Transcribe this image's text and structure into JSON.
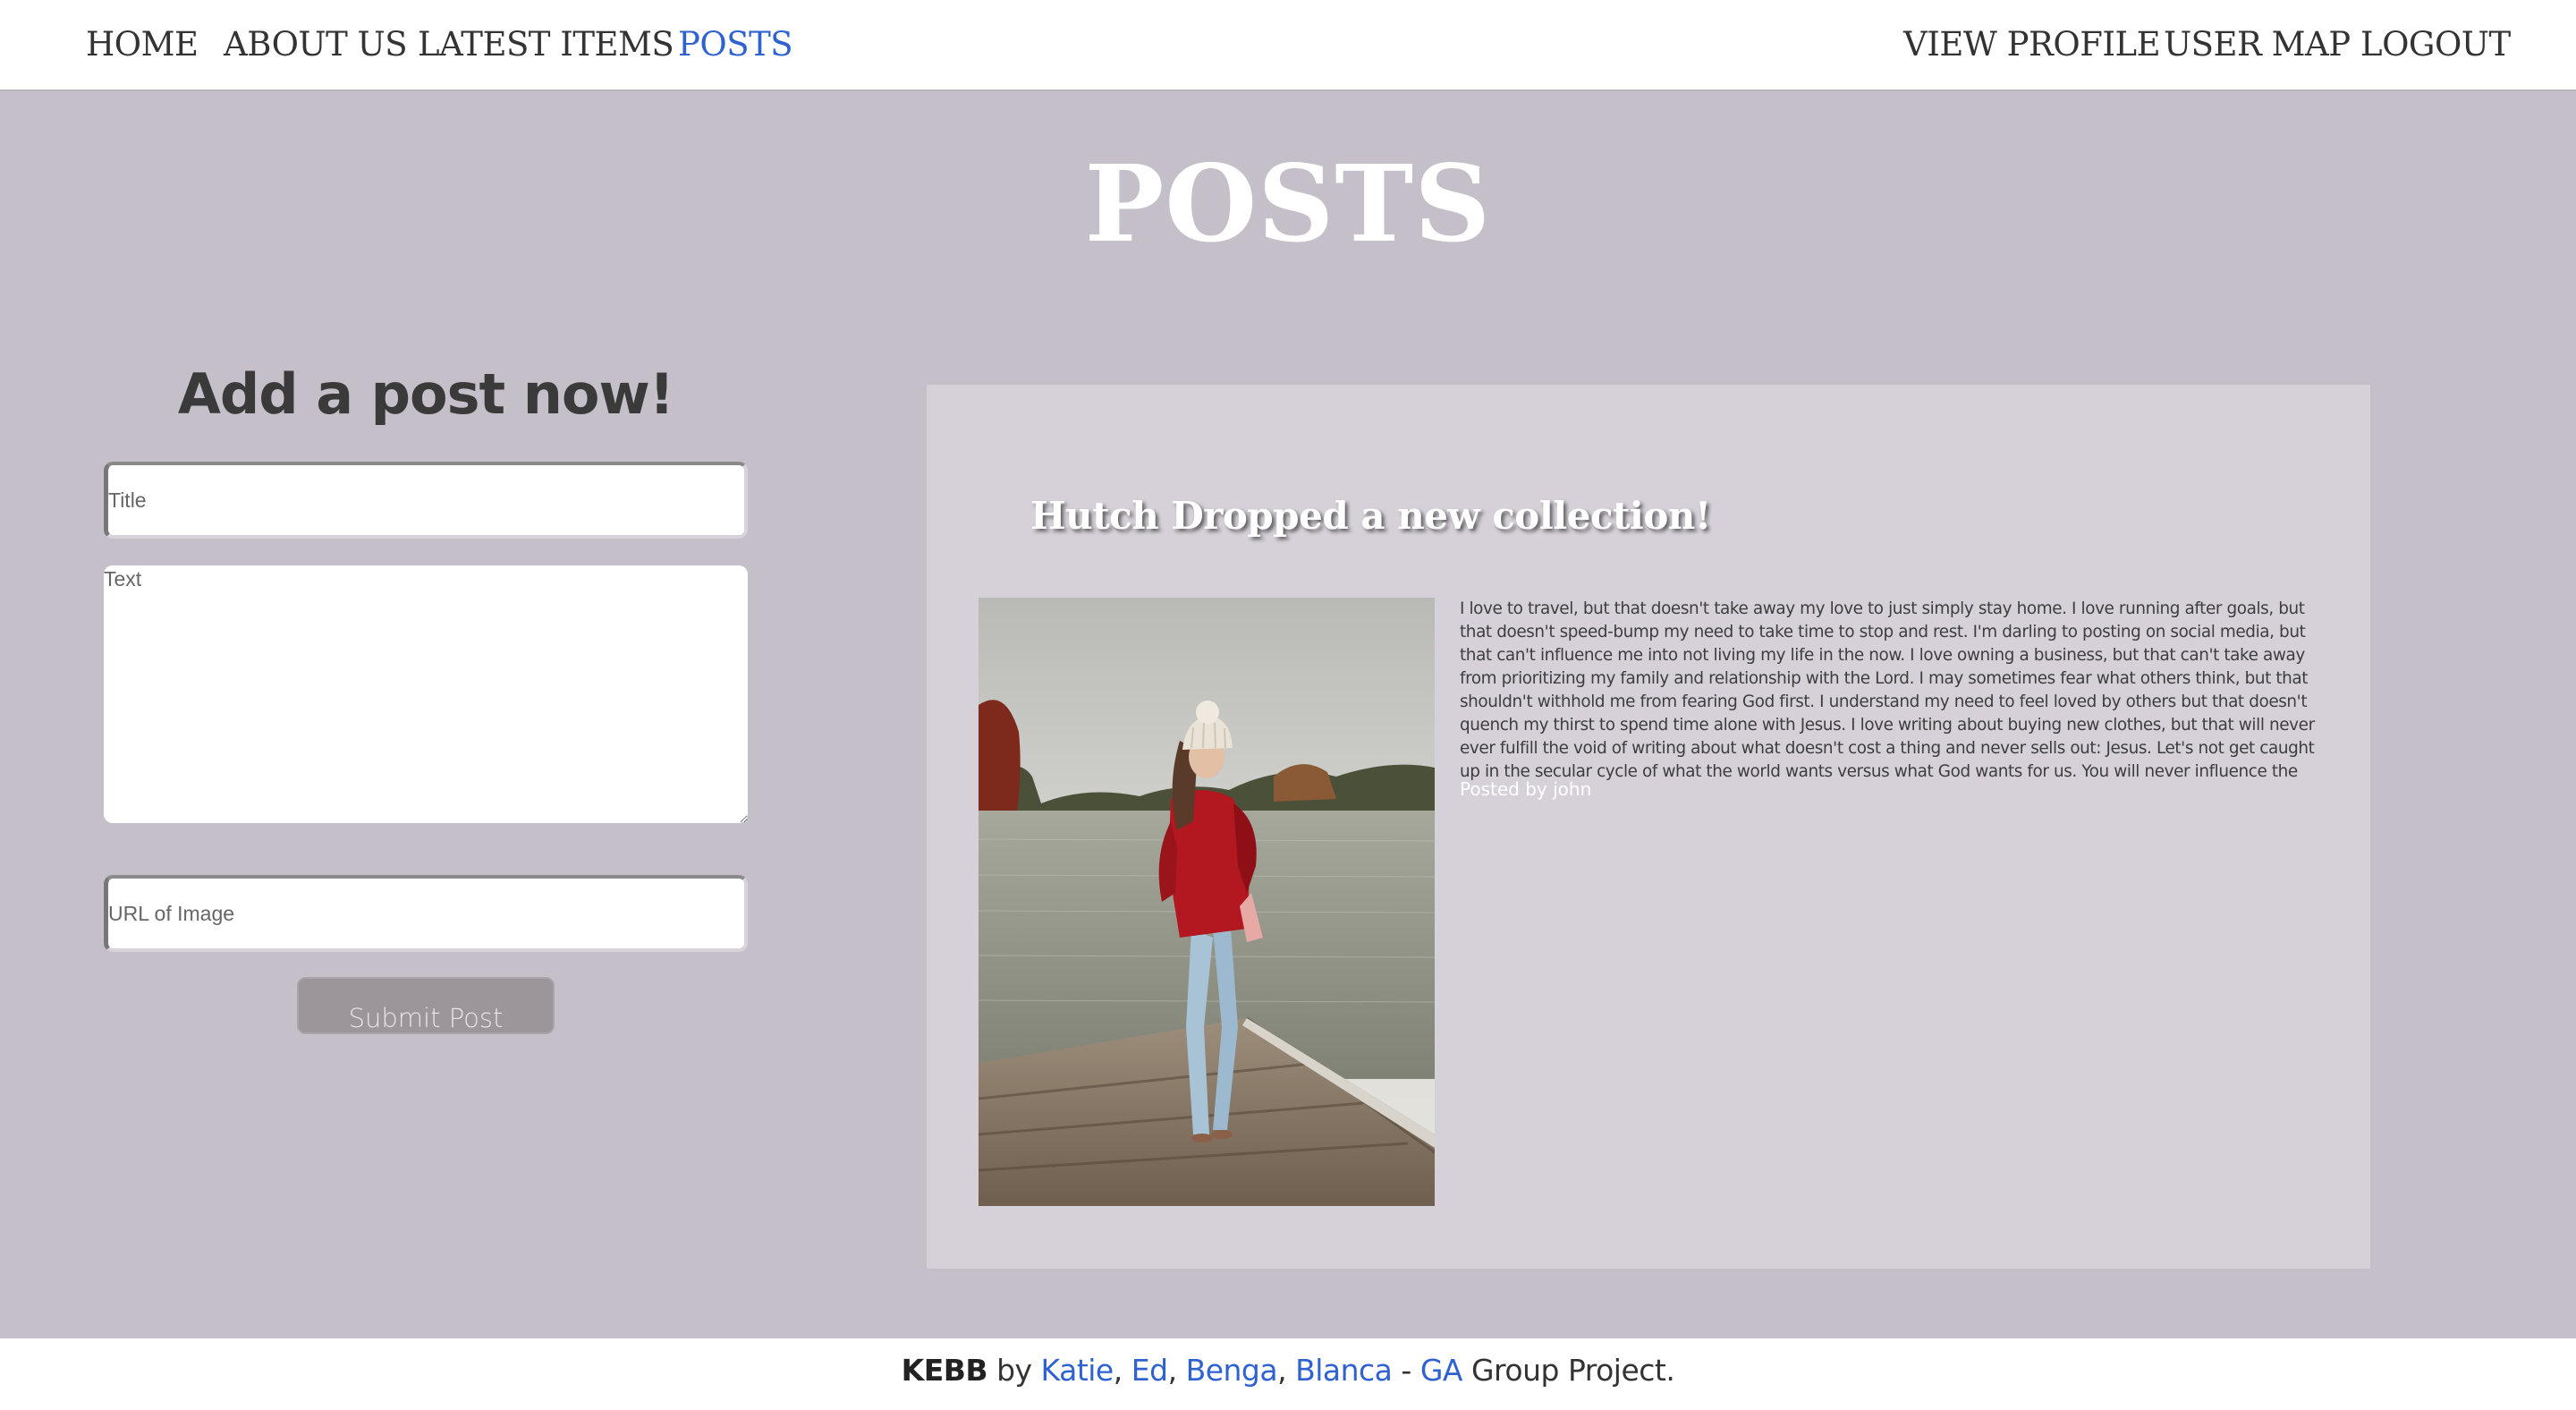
{
  "nav": {
    "left": [
      {
        "label": "HOME"
      },
      {
        "label": "ABOUT US"
      },
      {
        "label": "LATEST ITEMS"
      },
      {
        "label": "POSTS",
        "active": true
      }
    ],
    "right": [
      {
        "label": "VIEW PROFILE"
      },
      {
        "label": "USER MAP"
      },
      {
        "label": "LOGOUT"
      }
    ],
    "active_color": "#2f62d0"
  },
  "page": {
    "title": "POSTS"
  },
  "form": {
    "heading": "Add a post now!",
    "title_placeholder": "Title",
    "title_value": "",
    "text_placeholder": "Text",
    "text_value": "",
    "image_placeholder": "URL of Image",
    "image_value": "",
    "submit_label": "Submit Post"
  },
  "post": {
    "title": "Hutch Dropped a new collection!",
    "body": "I love to travel, but that doesn't take away my love to just simply stay home. I love running after goals, but that doesn't speed-bump my need to take time to stop and rest. I'm darling to posting on social media, but that can't influence me into not living my life in the now. I love owning a business, but that can't take away from prioritizing my family and relationship with the Lord. I may sometimes fear what others think, but that shouldn't withhold me from fearing God first. I understand my need to feel loved by others but that doesn't quench my thirst to spend time alone with Jesus. I love writing about buying new clothes, but that will never ever fulfill the void of writing about what doesn't cost a thing and never sells out: Jesus. Let's not get caught up in the secular cycle of what the world wants versus what God wants for us. You will never influence the world by",
    "posted_by_prefix": "Posted by",
    "author": "john"
  },
  "footer": {
    "brand": "KEBB",
    "by": "by",
    "authors": [
      "Katie",
      "Ed",
      "Benga",
      "Blanca"
    ],
    "dash": "-",
    "ga": "GA",
    "suffix": "Group Project."
  },
  "colors": {
    "page_bg": "#c4bfc8",
    "card_bg": "#d6d1d9",
    "link": "#2f62d0",
    "button": "#9c9599"
  }
}
